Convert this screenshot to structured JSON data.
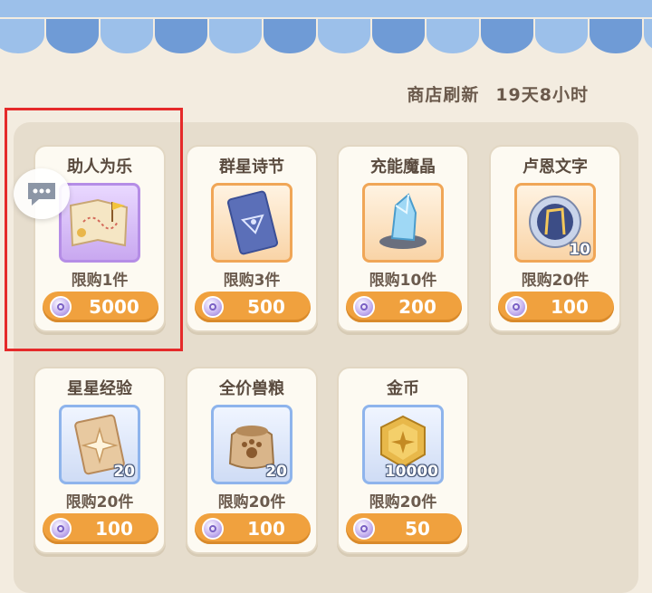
{
  "shop": {
    "refresh_label": "商店刷新",
    "refresh_time": "19天8小时"
  },
  "items": [
    {
      "name": "助人为乐",
      "icon": "treasure-map-icon",
      "frame": "purple",
      "quantity": "",
      "limit": "限购1件",
      "price": "5000"
    },
    {
      "name": "群星诗节",
      "icon": "blue-card-icon",
      "frame": "orange",
      "quantity": "",
      "limit": "限购3件",
      "price": "500"
    },
    {
      "name": "充能魔晶",
      "icon": "crystal-icon",
      "frame": "orange",
      "quantity": "",
      "limit": "限购10件",
      "price": "200"
    },
    {
      "name": "卢恩文字",
      "icon": "rune-orb-icon",
      "frame": "orange",
      "quantity": "10",
      "limit": "限购20件",
      "price": "100"
    },
    {
      "name": "星星经验",
      "icon": "star-card-icon",
      "frame": "blue",
      "quantity": "20",
      "limit": "限购20件",
      "price": "100"
    },
    {
      "name": "全价兽粮",
      "icon": "pet-food-bag-icon",
      "frame": "blue",
      "quantity": "20",
      "limit": "限购20件",
      "price": "100"
    },
    {
      "name": "金币",
      "icon": "gold-coin-icon",
      "frame": "blue",
      "quantity": "10000",
      "limit": "限购20件",
      "price": "50"
    }
  ],
  "currency_icon": "purple-gem-coin-icon",
  "colors": {
    "price_pill": "#f0a13e",
    "highlight": "#e52a2a",
    "awning_blue": "#7fa8dc"
  }
}
